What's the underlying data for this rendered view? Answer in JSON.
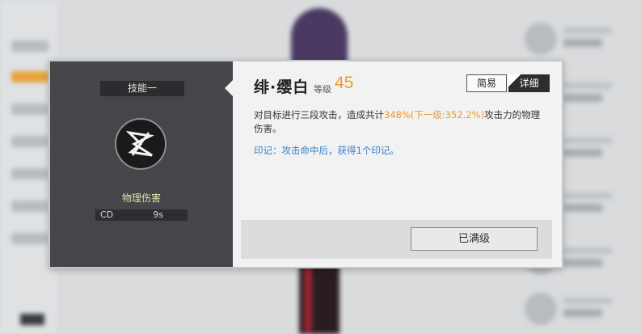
{
  "popup": {
    "skill_tag": "技能一",
    "skill_icon": "slash-swords-icon",
    "damage_type": "物理伤害",
    "cd_label": "CD",
    "cd_value": "9s",
    "title": "绯·缨白",
    "level_label": "等级",
    "level_value": "45",
    "btn_simple": "简易",
    "btn_detail": "详细",
    "desc_prefix": "对目标进行三段攻击，造成共计",
    "desc_highlight": "348%(下一级:352.2%)",
    "desc_suffix": "攻击力的物理伤害。",
    "mark_text": "印记：攻击命中后，获得1个印记。",
    "max_level_button": "已满级"
  },
  "colors": {
    "accent_orange": "#f09a2a",
    "mark_blue": "#3a7ec9",
    "damage_yellow": "#e5e0a6"
  }
}
